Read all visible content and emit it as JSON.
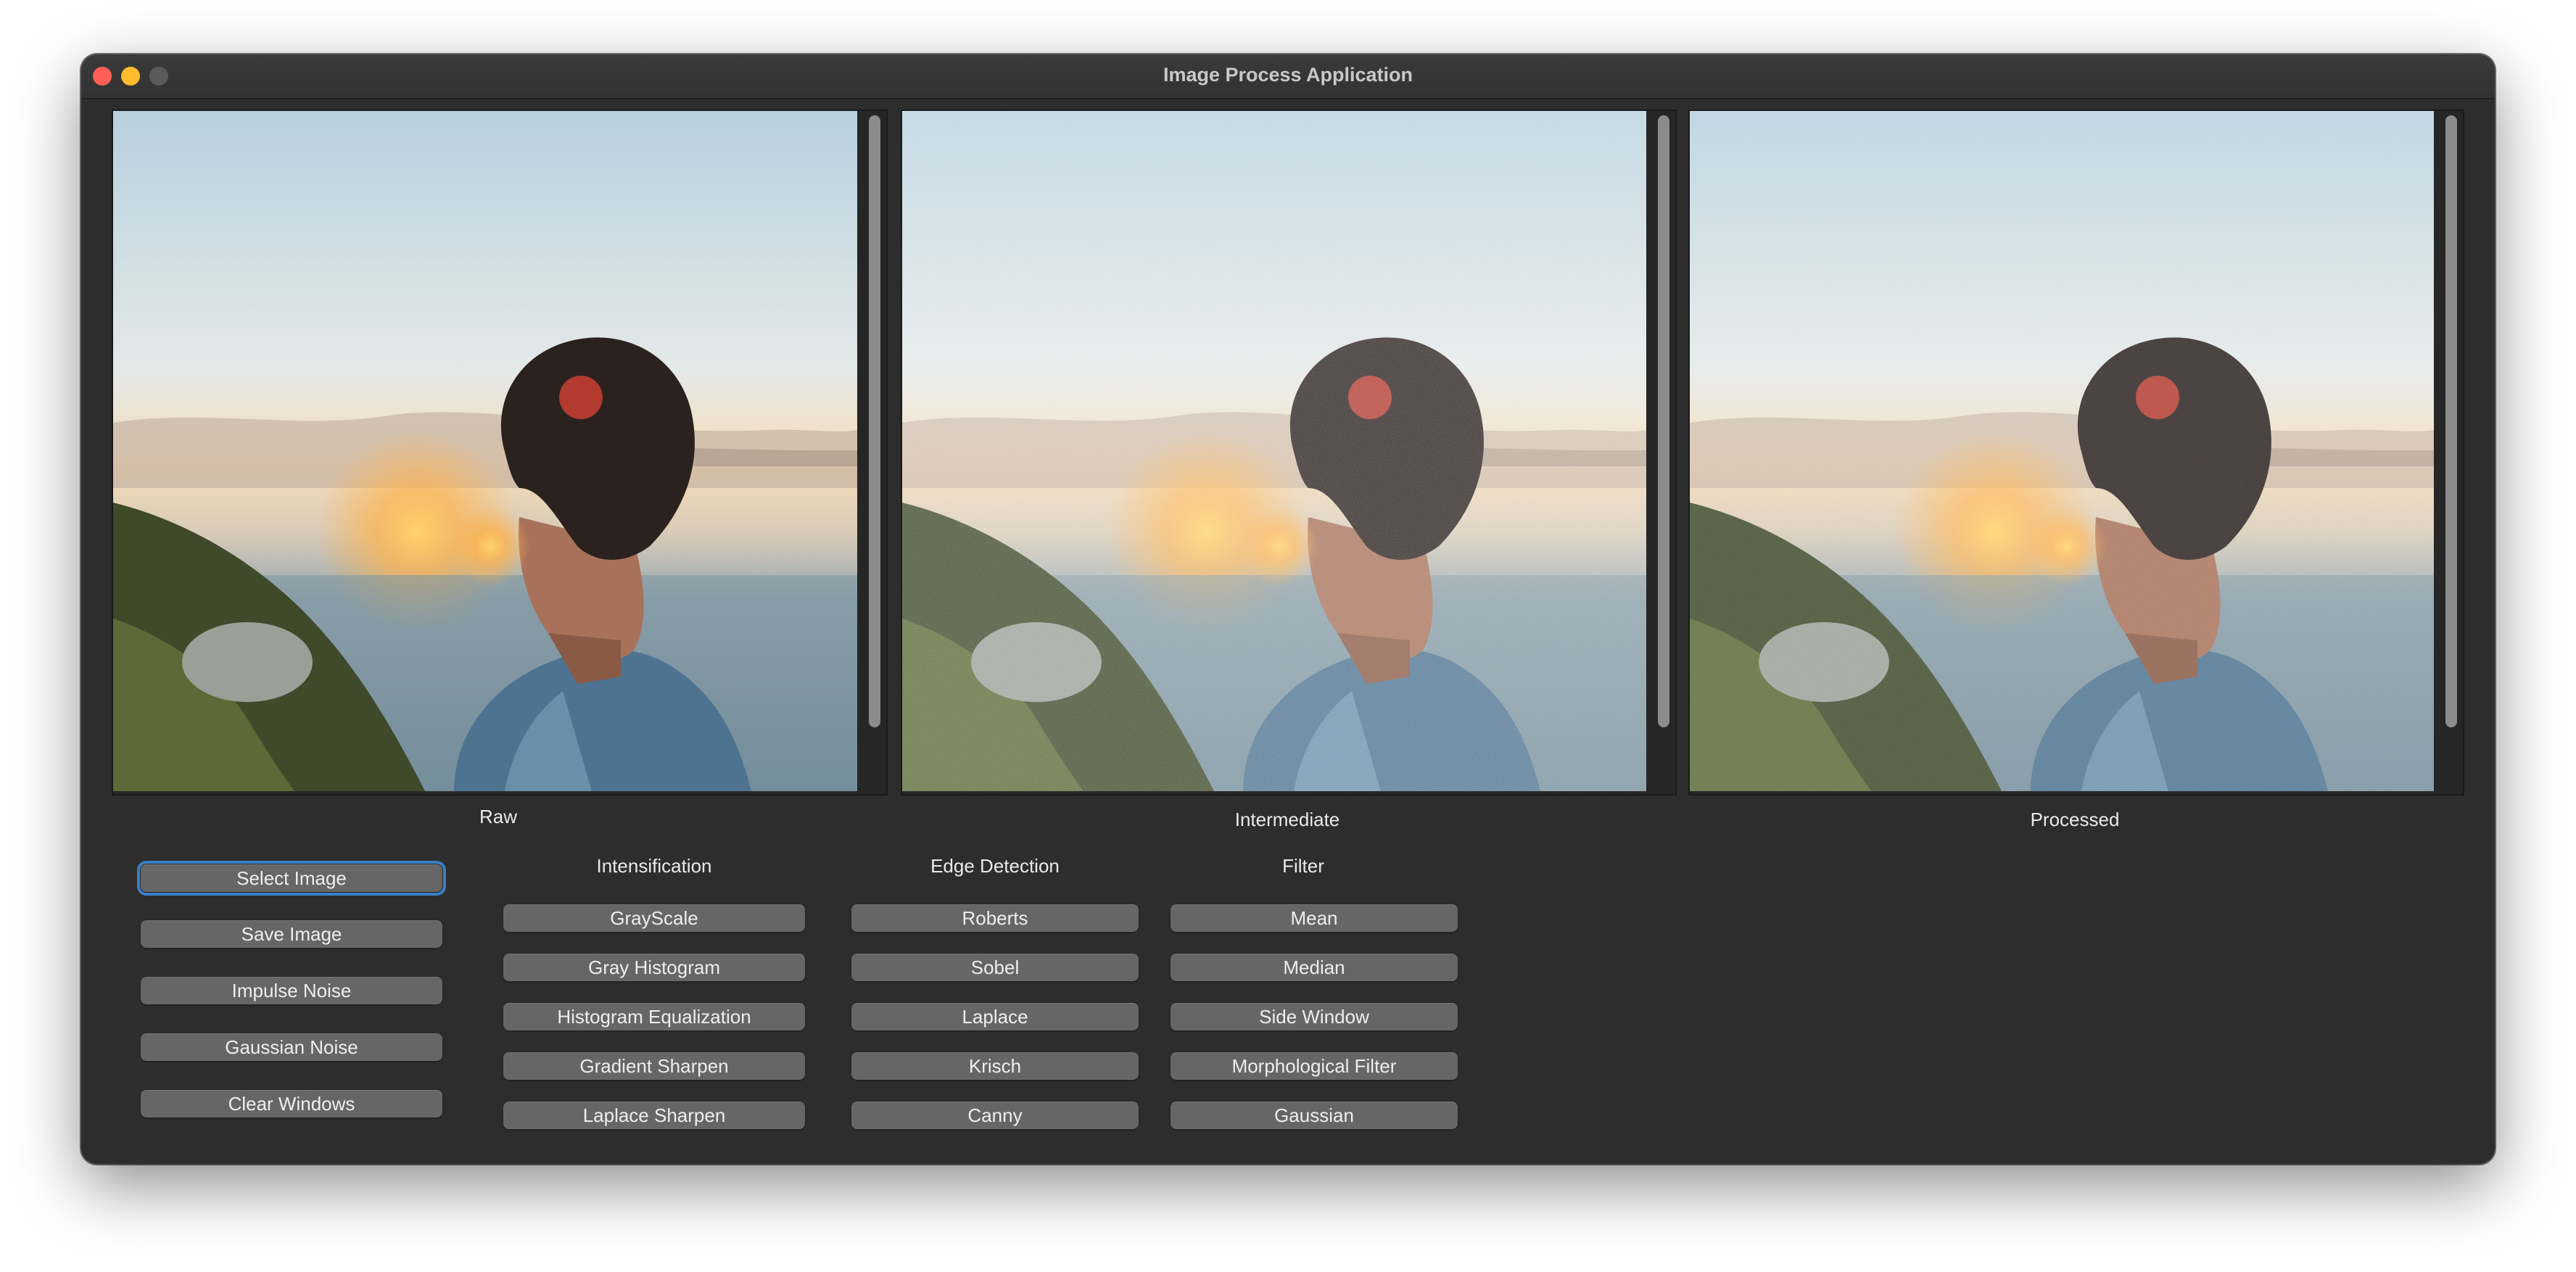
{
  "window": {
    "title": "Image Process Application",
    "controls": [
      "close",
      "minimize",
      "maximize"
    ]
  },
  "panels": [
    {
      "label": "Raw",
      "image": "raw-photo"
    },
    {
      "label": "Intermediate",
      "image": "noisy-photo"
    },
    {
      "label": "Processed",
      "image": "processed-photo"
    }
  ],
  "actions": {
    "select_image": "Select Image",
    "save_image": "Save Image",
    "impulse_noise": "Impulse Noise",
    "gaussian_noise": "Gaussian Noise",
    "clear_windows": "Clear Windows"
  },
  "groups": {
    "intensification": {
      "title": "Intensification",
      "buttons": [
        "GrayScale",
        "Gray Histogram",
        "Histogram Equalization",
        "Gradient Sharpen",
        "Laplace Sharpen"
      ]
    },
    "edge_detection": {
      "title": "Edge Detection",
      "buttons": [
        "Roberts",
        "Sobel",
        "Laplace",
        "Krisch",
        "Canny"
      ]
    },
    "filter": {
      "title": "Filter",
      "buttons": [
        "Mean",
        "Median",
        "Side Window",
        "Morphological Filter",
        "Gaussian"
      ]
    }
  },
  "colors": {
    "window_bg": "#2d2d2d",
    "button_bg": "#666666",
    "focus_ring": "#3a7fc4",
    "close": "#ff5f57",
    "minimize": "#febc2e"
  }
}
